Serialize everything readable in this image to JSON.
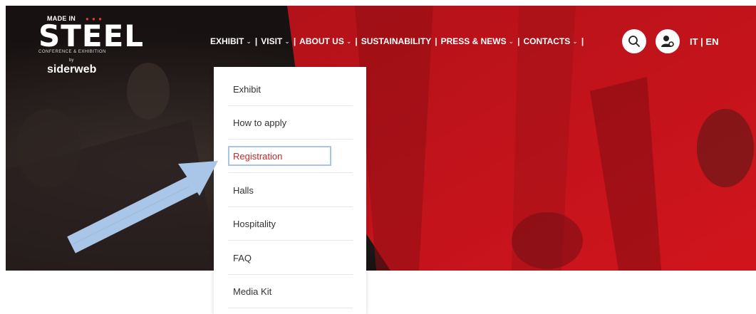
{
  "brand": {
    "made_in": "MADE IN",
    "name": "STEEL",
    "tagline": "CONFERENCE & EXHIBITION",
    "by": "by",
    "partner": "siderweb"
  },
  "nav": {
    "items": [
      {
        "label": "EXHIBIT",
        "dropdown": true
      },
      {
        "label": "VISIT",
        "dropdown": true
      },
      {
        "label": "ABOUT US",
        "dropdown": true
      },
      {
        "label": "SUSTAINABILITY",
        "dropdown": false
      },
      {
        "label": "PRESS & NEWS",
        "dropdown": true
      },
      {
        "label": "CONTACTS",
        "dropdown": true
      }
    ],
    "separator": "|",
    "language": "IT | EN"
  },
  "icons": {
    "search": "search-icon",
    "user": "user-settings-icon",
    "chevron": "chevron-down-icon"
  },
  "dropdown": {
    "items": [
      "Exhibit",
      "How to apply",
      "Registration",
      "Halls",
      "Hospitality",
      "FAQ",
      "Media Kit"
    ],
    "active": "Registration"
  },
  "colors": {
    "accent_red": "#c62828",
    "highlight_box": "#a9c6e8",
    "annotation_arrow": "#a9c6e8"
  }
}
